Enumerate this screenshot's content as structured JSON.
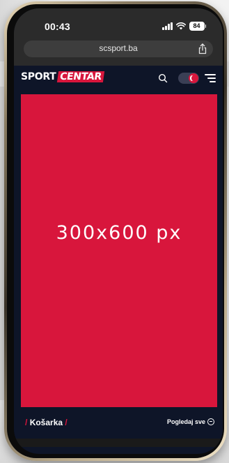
{
  "status_bar": {
    "time": "00:43",
    "battery": "84"
  },
  "browser": {
    "url": "scsport.ba"
  },
  "site": {
    "logo_part1": "SPORT",
    "logo_part2": "CENTAR"
  },
  "ad": {
    "text": "300x600 px"
  },
  "section": {
    "slash": "/",
    "title": "Košarka",
    "view_all": "Pogledaj sve"
  },
  "colors": {
    "accent": "#d8163c",
    "header_bg": "#0e1528",
    "browser_bg": "#2b2b2b"
  },
  "icons": [
    "signal-icon",
    "wifi-icon",
    "battery-icon",
    "share-icon",
    "search-icon",
    "theme-toggle",
    "menu-icon",
    "arrow-circle-icon"
  ]
}
